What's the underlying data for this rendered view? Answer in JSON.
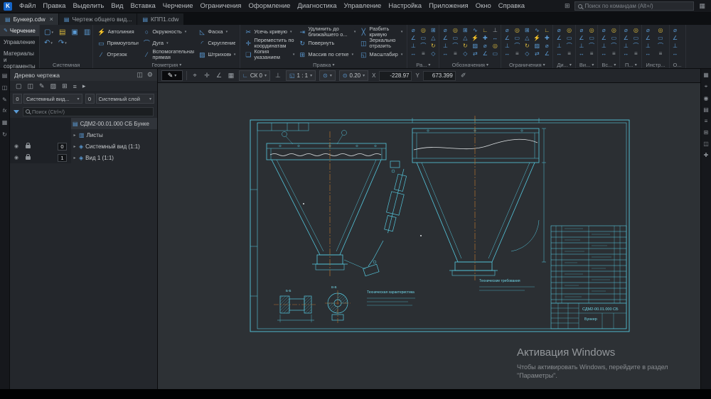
{
  "glyphs": {
    "logo": "K",
    "apps": "⊞",
    "window": "▦",
    "doc": "▤",
    "close": "×",
    "new_doc": "▢",
    "open": "▤",
    "save": "▣",
    "print": "▥",
    "undo": "↶",
    "redo": "↷",
    "pencil": "✎",
    "snap": "⌖",
    "move4": "✛",
    "angle": "∠",
    "grid": "▦",
    "cs": "∟",
    "ortho": "⊥",
    "scale_icon": "◱",
    "zoom": "⊙",
    "eyedropper": "✐",
    "gear": "⚙",
    "panel": "◫",
    "folder": "▥",
    "arrow": "▸",
    "eye": "◉",
    "view": "◈",
    "lstrip": [
      "▤",
      "◫",
      "✎",
      "fx",
      "▦",
      "↻"
    ],
    "rstrip": [
      "▦",
      "⌖",
      "◉",
      "▤",
      "≡",
      "⊞",
      "◫",
      "✚"
    ],
    "tree_toolbar": [
      "▢",
      "◫",
      "✎",
      "▨",
      "⊞",
      "≡",
      "▸"
    ],
    "mini": [
      "⌀",
      "∠",
      "⊥",
      "↔",
      "◎",
      "▭",
      "⌒",
      "≡",
      "⊞",
      "△",
      "↻",
      "◇",
      "∿",
      "⚡",
      "▨",
      "⇄",
      "∟",
      "✚"
    ]
  },
  "menubar": {
    "items": [
      "Файл",
      "Правка",
      "Выделить",
      "Вид",
      "Вставка",
      "Черчение",
      "Ограничения",
      "Оформление",
      "Диагностика",
      "Управление",
      "Настройка",
      "Приложения",
      "Окно",
      "Справка"
    ],
    "search_placeholder": "Поиск по командам (Alt+/)"
  },
  "tabbar": {
    "tabs": [
      {
        "label": "Бункер.cdw"
      },
      {
        "label": "Чертеж общего вид..."
      },
      {
        "label": "КПП1.cdw"
      }
    ]
  },
  "side_tabs": {
    "items": [
      "Черчение",
      "Управление",
      "Материалы и сортаменты"
    ]
  },
  "ribbon": {
    "system_label": "Системная",
    "geometry_label": "Геометрия",
    "edit_label": "Правка",
    "geometry_tools": [
      {
        "label": "Автолиния",
        "icon": "⚡"
      },
      {
        "label": "Прямоугольник",
        "icon": "▭"
      },
      {
        "label": "Отрезок",
        "icon": "∕"
      },
      {
        "label": "Окружность",
        "icon": "○"
      },
      {
        "label": "Дуга",
        "icon": "⌒"
      },
      {
        "label": "Вспомогательная прямая",
        "icon": "⁄"
      },
      {
        "label": "Фаска",
        "icon": "◺"
      },
      {
        "label": "Скругление",
        "icon": "◜"
      },
      {
        "label": "Штриховка",
        "icon": "▨"
      }
    ],
    "edit_tools": [
      {
        "label": "Усечь кривую",
        "icon": "✂"
      },
      {
        "label": "Переместить по координатам",
        "icon": "✛"
      },
      {
        "label": "Копия указанием",
        "icon": "❏"
      },
      {
        "label": "Удлинить до ближайшего о...",
        "icon": "⇥"
      },
      {
        "label": "Повернуть",
        "icon": "↻"
      },
      {
        "label": "Массив по сетке",
        "icon": "⊞"
      },
      {
        "label": "Разбить кривую",
        "icon": "╳"
      },
      {
        "label": "Зеркально отразить",
        "icon": "◫"
      },
      {
        "label": "Масштабиро...",
        "icon": "◱"
      }
    ],
    "mini_groups": [
      {
        "label": "Ра..."
      },
      {
        "label": "Обозначения"
      },
      {
        "label": "Ограничения"
      },
      {
        "label": "Ди..."
      },
      {
        "label": "Ви..."
      },
      {
        "label": "Вс..."
      },
      {
        "label": "П..."
      },
      {
        "label": "Инстр..."
      },
      {
        "label": "О..."
      }
    ]
  },
  "quickbar": {
    "cs_label": "СК 0",
    "scale_label": "1 : 1",
    "zoom_value": "0.20",
    "x_label": "X",
    "x_value": "-228.97",
    "y_label": "Y",
    "y_value": "673.399"
  },
  "tree_panel": {
    "title": "Дерево чертежа",
    "view_spin": "0",
    "view_dropdown": "Системный вид...",
    "layer_spin": "0",
    "layer_dropdown": "Системный слой",
    "search_placeholder": "Поиск (Ctrl+/)",
    "items": [
      {
        "label": "СДМ2-00.01.000 СБ Бунке"
      },
      {
        "label": "Листы"
      },
      {
        "label": "Системный вид (1:1)",
        "badge": "0"
      },
      {
        "label": "Вид 1 (1:1)",
        "badge": "1"
      }
    ]
  },
  "drawing": {
    "tech_char_title": "Техническая характеристика",
    "tech_req_title": "Технические требования",
    "detail_a_label": "Б-Б",
    "detail_b_label": "В-В",
    "title_doc": "СДМ2-00.01.000 СБ",
    "title_name": "Бункер"
  },
  "watermark": {
    "title": "Активация Windows",
    "line1": "Чтобы активировать Windows, перейдите в раздел",
    "line2": "\"Параметры\"."
  }
}
